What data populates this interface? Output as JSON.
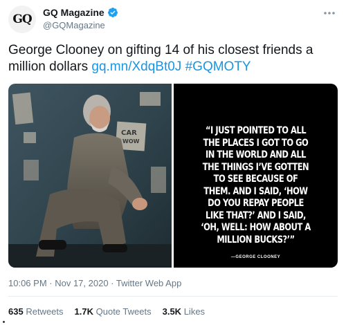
{
  "author": {
    "avatar_text": "GQ",
    "name": "GQ Magazine",
    "handle": "@GQMagazine",
    "verified_icon": "verified-badge-icon"
  },
  "more_icon": "more-horizontal-icon",
  "tweet": {
    "text": "George Clooney on gifting 14 of his closest friends a million dollars",
    "link": "gq.mn/XdqBt0J",
    "hashtag": "#GQMOTY"
  },
  "media": {
    "photo_icon": "george-clooney-photo",
    "photo_sign_text": "CAR WOW",
    "quote_lines": [
      "“I JUST POINTED TO ALL",
      "THE PLACES I GOT TO GO",
      "IN THE WORLD AND ALL",
      "THE THINGS I’VE GOTTEN",
      "TO SEE BECAUSE OF",
      "THEM. AND I SAID, ‘HOW",
      "DO YOU REPAY PEOPLE",
      "LIKE THAT?’ AND I SAID,",
      "‘OH, WELL: HOW ABOUT A",
      "MILLION BUCKS?’”"
    ],
    "attribution": "—GEORGE CLOONEY"
  },
  "meta": {
    "time": "10:06 PM",
    "sep1": " · ",
    "date": "Nov 17, 2020",
    "sep2": " · ",
    "source": "Twitter Web App"
  },
  "stats": {
    "retweets_count": "635",
    "retweets_label": "Retweets",
    "quotes_count": "1.7K",
    "quotes_label": "Quote Tweets",
    "likes_count": "3.5K",
    "likes_label": "Likes"
  },
  "colors": {
    "link": "#1b95e0",
    "verified": "#1da1f2",
    "muted": "#657786"
  }
}
